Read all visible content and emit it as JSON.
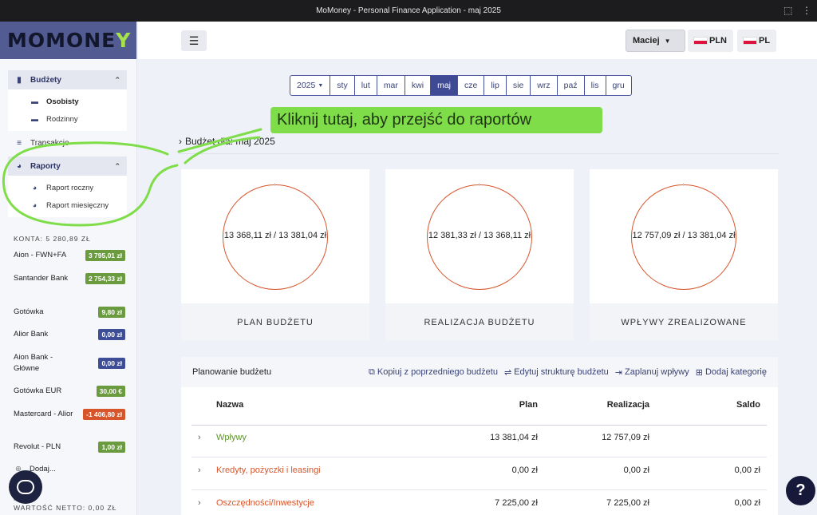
{
  "window": {
    "title": "MoMoney - Personal Finance Application - maj 2025"
  },
  "logo": {
    "part1": "MOMONE",
    "part2": "Y"
  },
  "sidebar": {
    "budzety": {
      "label": "Budżety",
      "items": [
        "Osobisty",
        "Rodzinny"
      ]
    },
    "transakcje": "Transakcje",
    "raporty": {
      "label": "Raporty",
      "items": [
        "Raport roczny",
        "Raport miesięczny"
      ]
    },
    "konta": "KONTA: 5 280,89 ZŁ",
    "accounts": [
      {
        "name": "Aion - FWN+FA",
        "amount": "3 795,01 zł",
        "color": "green"
      },
      {
        "name": "Santander Bank",
        "amount": "2 754,33 zł",
        "color": "green"
      },
      {
        "name": "Gotówka",
        "amount": "9,80 zł",
        "color": "green"
      },
      {
        "name": "Alior Bank",
        "amount": "0,00 zł",
        "color": "blue"
      },
      {
        "name": "Aion Bank - Główne",
        "amount": "0,00 zł",
        "color": "blue"
      },
      {
        "name": "Gotówka EUR",
        "amount": "30,00 €",
        "color": "green"
      },
      {
        "name": "Mastercard - Alior",
        "amount": "-1 406,80 zł",
        "color": "red"
      },
      {
        "name": "Revolut - PLN",
        "amount": "1,00 zł",
        "color": "green"
      }
    ],
    "add": "Dodaj...",
    "netto": "WARTOŚĆ NETTO: 0,00 ZŁ",
    "netto_prefix": "N..."
  },
  "header": {
    "user": "Maciej",
    "currency": "PLN",
    "language": "PL"
  },
  "months": {
    "year": "2025",
    "items": [
      "sty",
      "lut",
      "mar",
      "kwi",
      "maj",
      "cze",
      "lip",
      "sie",
      "wrz",
      "paź",
      "lis",
      "gru"
    ],
    "active": "maj"
  },
  "callout": "Kliknij tutaj, aby przejść do raportów",
  "budget_title": "Budżet dla: maj 2025",
  "cards": [
    {
      "value": "13 368,11 zł / 13 381,04 zł",
      "label": "PLAN BUDŻETU"
    },
    {
      "value": "12 381,33 zł / 13 368,11 zł",
      "label": "REALIZACJA BUDŻETU"
    },
    {
      "value": "12 757,09 zł / 13 381,04 zł",
      "label": "WPŁYWY ZREALIZOWANE"
    }
  ],
  "planning": {
    "title": "Planowanie budżetu",
    "actions": [
      "Kopiuj z poprzedniego budżetu",
      "Edytuj strukturę budżetu",
      "Zaplanuj wpływy",
      "Dodaj kategorię"
    ],
    "columns": [
      "Nazwa",
      "Plan",
      "Realizacja",
      "Saldo"
    ],
    "rows": [
      {
        "name": "Wpływy",
        "plan": "13 381,04 zł",
        "real": "12 757,09 zł",
        "saldo": ""
      },
      {
        "name": "Kredyty, pożyczki i leasingi",
        "plan": "0,00 zł",
        "real": "0,00 zł",
        "saldo": "0,00 zł"
      },
      {
        "name": "Oszczędności/Inwestycje",
        "plan": "7 225,00 zł",
        "real": "7 225,00 zł",
        "saldo": "0,00 zł"
      }
    ]
  },
  "help": "?"
}
